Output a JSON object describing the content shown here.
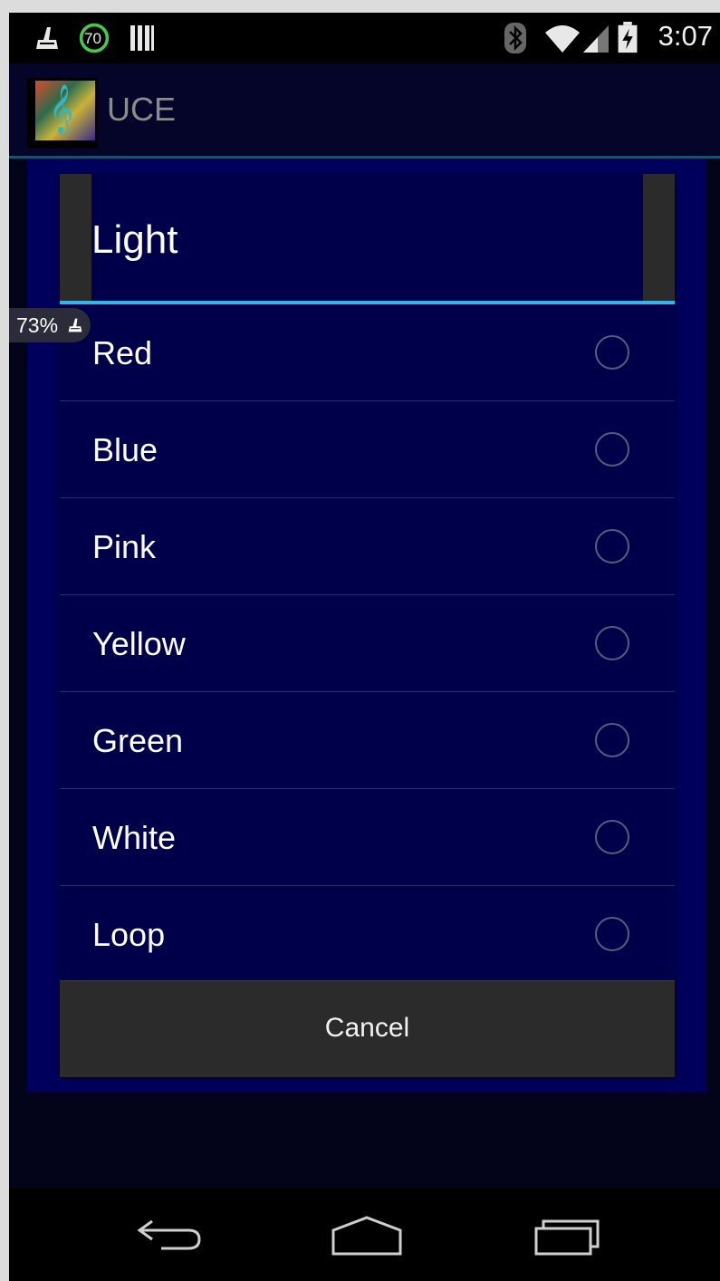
{
  "status_bar": {
    "notification_badge": "70",
    "clock": "3:07"
  },
  "app": {
    "title": "UCE"
  },
  "battery_overlay": {
    "percent": "73%"
  },
  "dialog": {
    "title": "Light",
    "options": [
      {
        "label": "Red",
        "selected": false
      },
      {
        "label": "Blue",
        "selected": false
      },
      {
        "label": "Pink",
        "selected": false
      },
      {
        "label": "Yellow",
        "selected": false
      },
      {
        "label": "Green",
        "selected": false
      },
      {
        "label": "White",
        "selected": false
      },
      {
        "label": "Loop",
        "selected": false
      }
    ],
    "cancel_label": "Cancel"
  },
  "nav": {
    "back_icon": "back-icon",
    "home_icon": "home-icon",
    "recents_icon": "recents-icon"
  },
  "colors": {
    "accent": "#33b5e5",
    "dialog_bg": "#00004a",
    "panel_bg": "#00005c",
    "status_bar_bg": "#000000"
  }
}
